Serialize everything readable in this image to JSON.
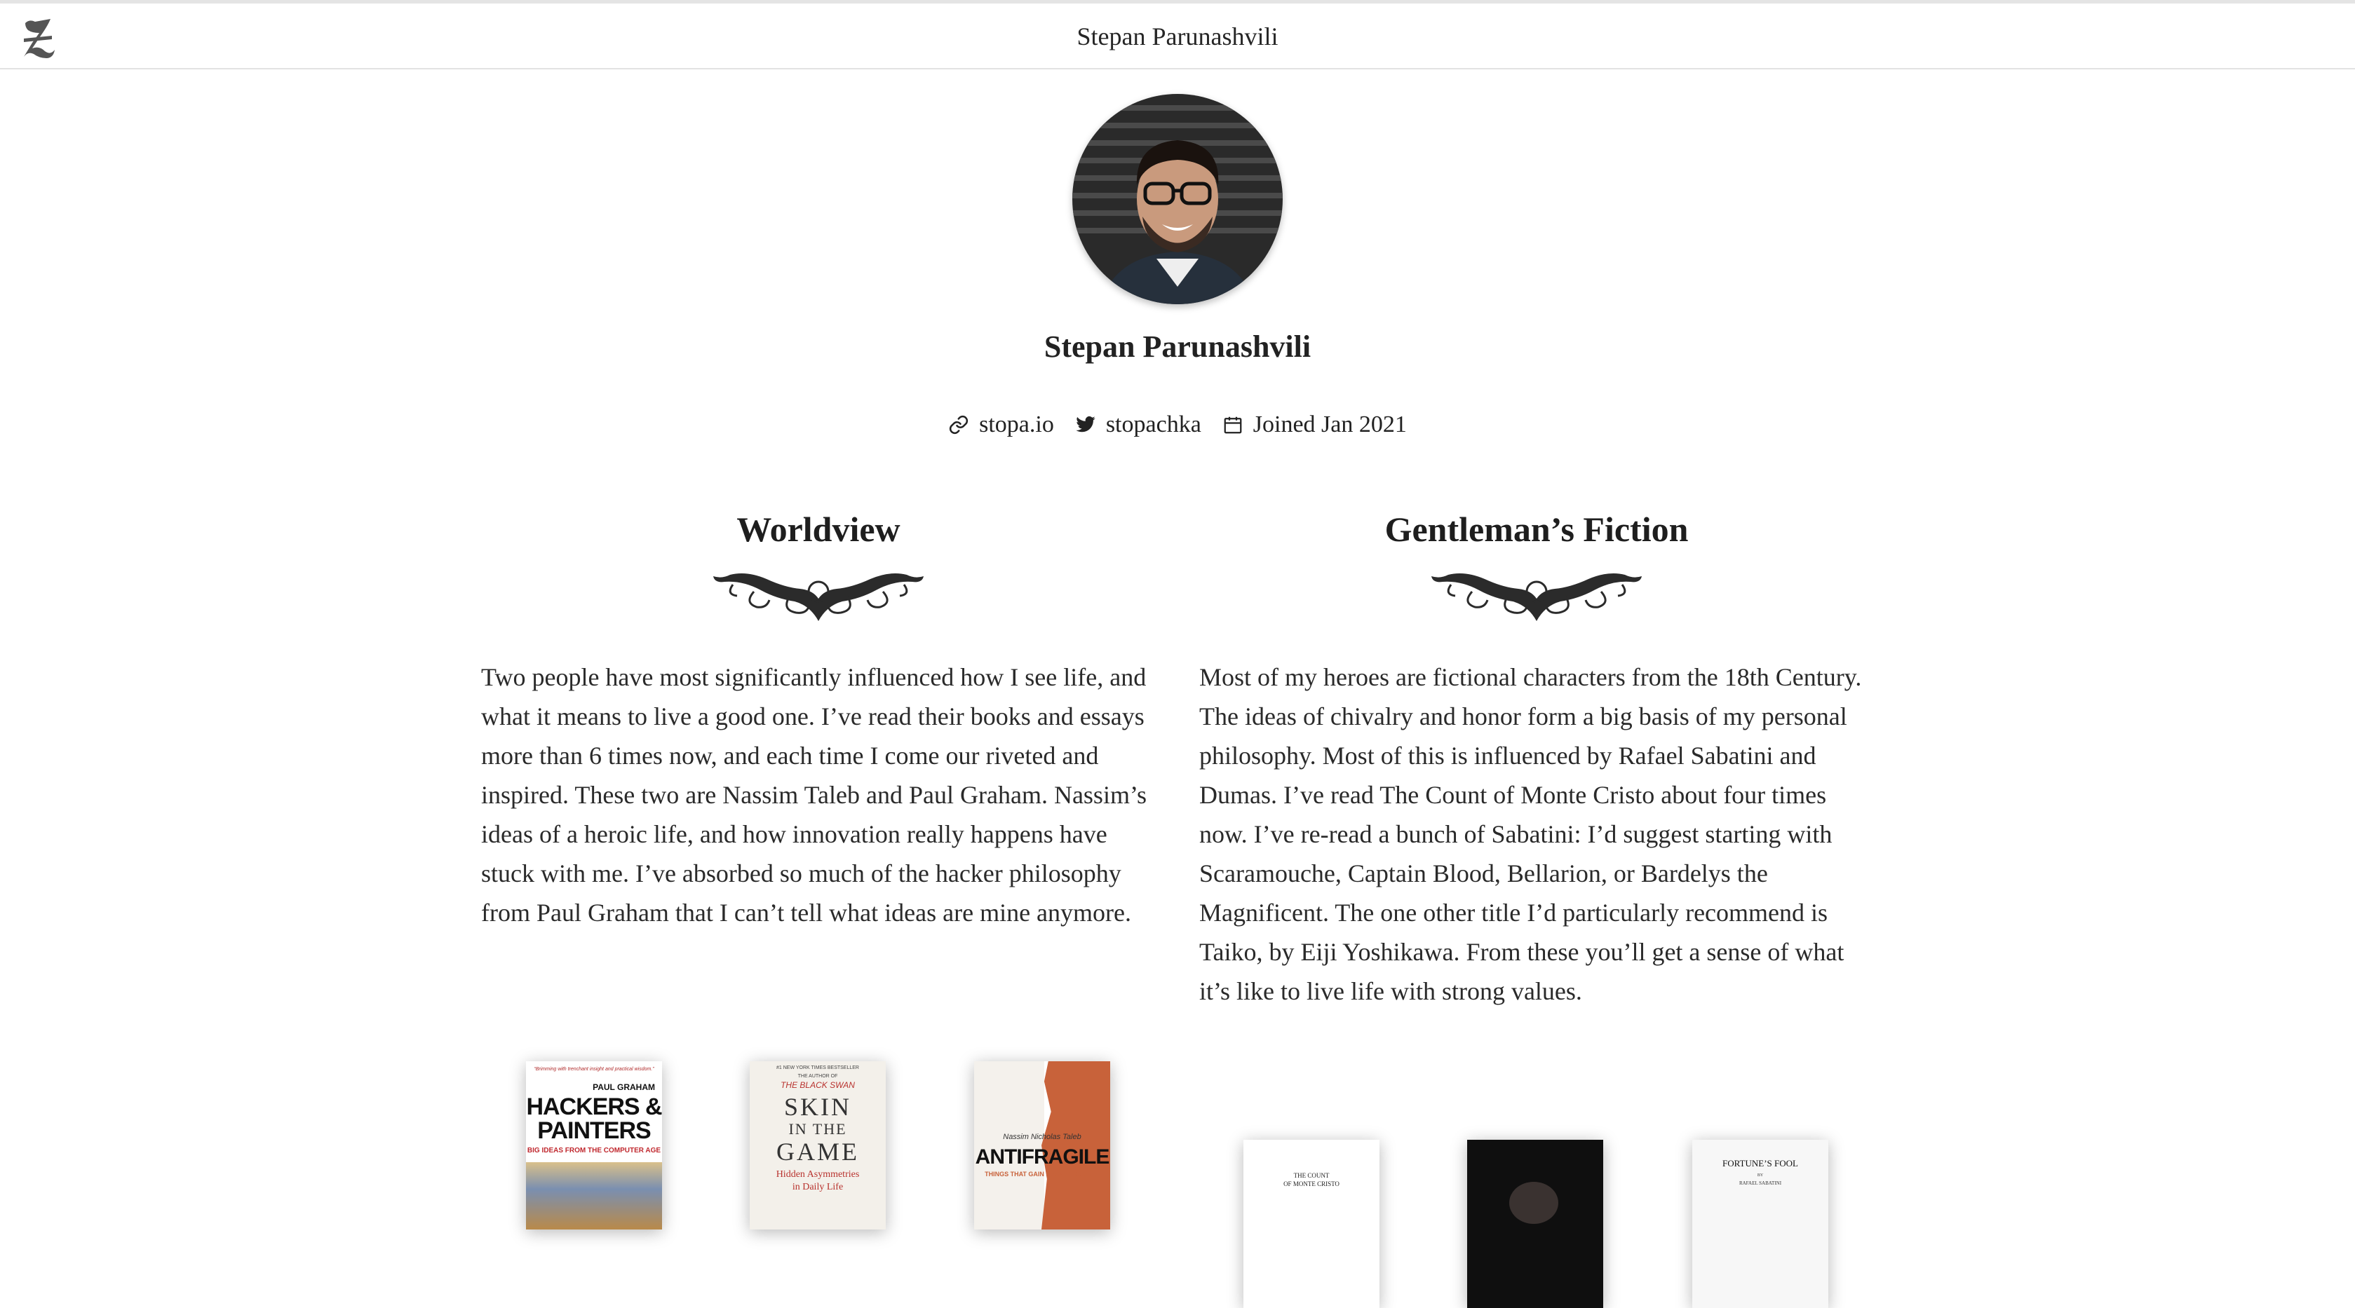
{
  "header": {
    "title": "Stepan Parunashvili",
    "logo_icon": "gothic-z-logo-icon"
  },
  "profile": {
    "name": "Stepan Parunashvili",
    "avatar_icon": "profile-photo",
    "website": "stopa.io",
    "twitter": "stopachka",
    "joined": "Joined Jan 2021"
  },
  "sections": [
    {
      "title": "Worldview",
      "body": "Two people have most significantly influenced how I see life, and what it means to live a good one. I’ve read their books and essays more than 6 times now, and each time I come our riveted and inspired. These two are Nassim Taleb and Paul Graham. Nassim’s ideas of a heroic life, and how innovation really happens have stuck with me. I’ve absorbed so much of the hacker philosophy from Paul Graham that I can’t tell what ideas are mine anymore.",
      "books": [
        {
          "quote": "“Brimming with trenchant insight and practical wisdom.”",
          "author": "PAUL GRAHAM",
          "title_line1": "HACKERS &",
          "title_line2": "PAINTERS",
          "subtitle": "BIG IDEAS FROM THE COMPUTER AGE"
        },
        {
          "badge": "#1 NEW YORK TIMES BESTSELLER",
          "byline": "THE AUTHOR OF",
          "series": "THE BLACK SWAN",
          "title_line1": "SKIN",
          "title_line2": "IN THE",
          "title_line3": "GAME",
          "subtitle_line1": "Hidden Asymmetries",
          "subtitle_line2": "in Daily Life"
        },
        {
          "author": "Nassim Nicholas Taleb",
          "title": "ANTIFRAGILE",
          "subtitle": "THINGS THAT GAIN FROM DISORDER"
        }
      ]
    },
    {
      "title": "Gentleman’s Fiction",
      "body": "Most of my heroes are fictional characters from the 18th Century. The ideas of chivalry and honor form a big basis of my personal philosophy. Most of this is influenced by Rafael Sabatini and Dumas. I’ve read The Count of Monte Cristo about four times now. I’ve re-read a bunch of Sabatini: I’d suggest starting with Scaramouche, Captain Blood, Bellarion, or Bardelys the Magnificent. The one other title I’d particularly recommend is Taiko, by Eiji Yoshikawa.  From these you’ll get a sense of what it’s like to live life with strong values.",
      "books": [
        {
          "title_line1": "THE COUNT",
          "title_line2": "OF MONTE CRISTO"
        },
        {
          "title": ""
        },
        {
          "title": "FORTUNE’S FOOL",
          "byline": "BY",
          "author": "RAFAEL SABATINI"
        }
      ]
    }
  ],
  "colors": {
    "antifragile_orange": "#c8623a",
    "text": "#2a2a2a",
    "divider": "#e2e2e2"
  }
}
